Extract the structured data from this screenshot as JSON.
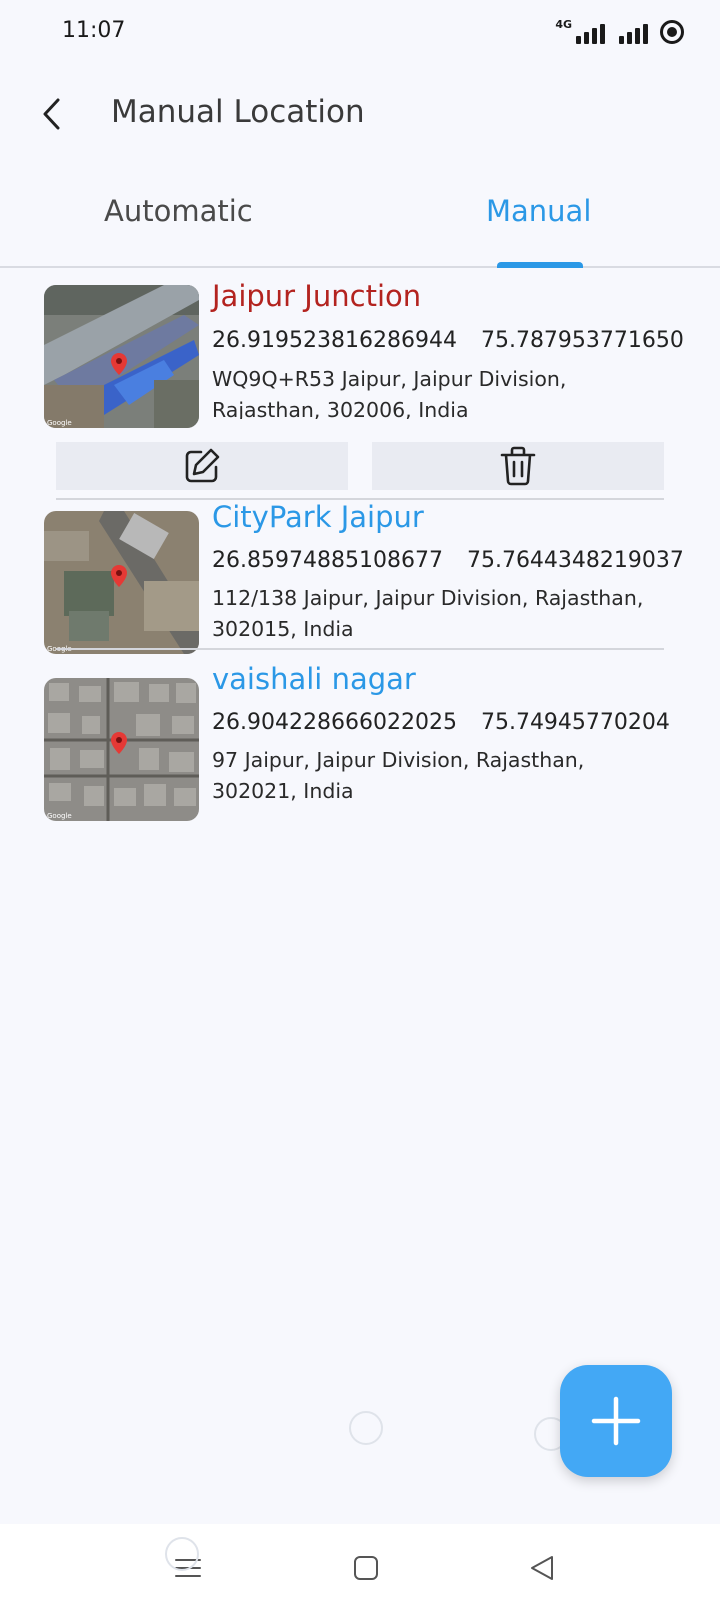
{
  "status_bar": {
    "time": "11:07",
    "network_label": "4G",
    "icons": [
      "signal-icon",
      "signal-icon",
      "screen-record-icon"
    ]
  },
  "header": {
    "title": "Manual Location",
    "back_icon": "back-arrow-icon"
  },
  "tabs": [
    {
      "label": "Automatic",
      "active": false
    },
    {
      "label": "Manual",
      "active": true
    }
  ],
  "colors": {
    "accent": "#2b98e6",
    "selected_name": "#b3231f",
    "fab": "#43a8f5",
    "background": "#f7f8fd"
  },
  "locations": [
    {
      "name": "Jaipur Junction",
      "latitude": "26.919523816286944",
      "longitude": "75.787953771650",
      "address": "WQ9Q+R53  Jaipur, Jaipur Division, Rajasthan, 302006, India",
      "selected": true,
      "actions": [
        "edit-icon",
        "delete-icon"
      ]
    },
    {
      "name": "CityPark Jaipur",
      "latitude": "26.85974885108677",
      "longitude": "75.7644348219037",
      "address": "112/138  Jaipur, Jaipur Division, Rajasthan, 302015, India",
      "selected": false
    },
    {
      "name": "vaishali nagar",
      "latitude": "26.904228666022025",
      "longitude": "75.74945770204",
      "address": "97  Jaipur, Jaipur Division, Rajasthan, 302021, India",
      "selected": false
    }
  ],
  "fab": {
    "icon": "plus-icon"
  },
  "nav_bar": {
    "icons": [
      "menu-icon",
      "home-square-icon",
      "back-triangle-icon"
    ]
  }
}
